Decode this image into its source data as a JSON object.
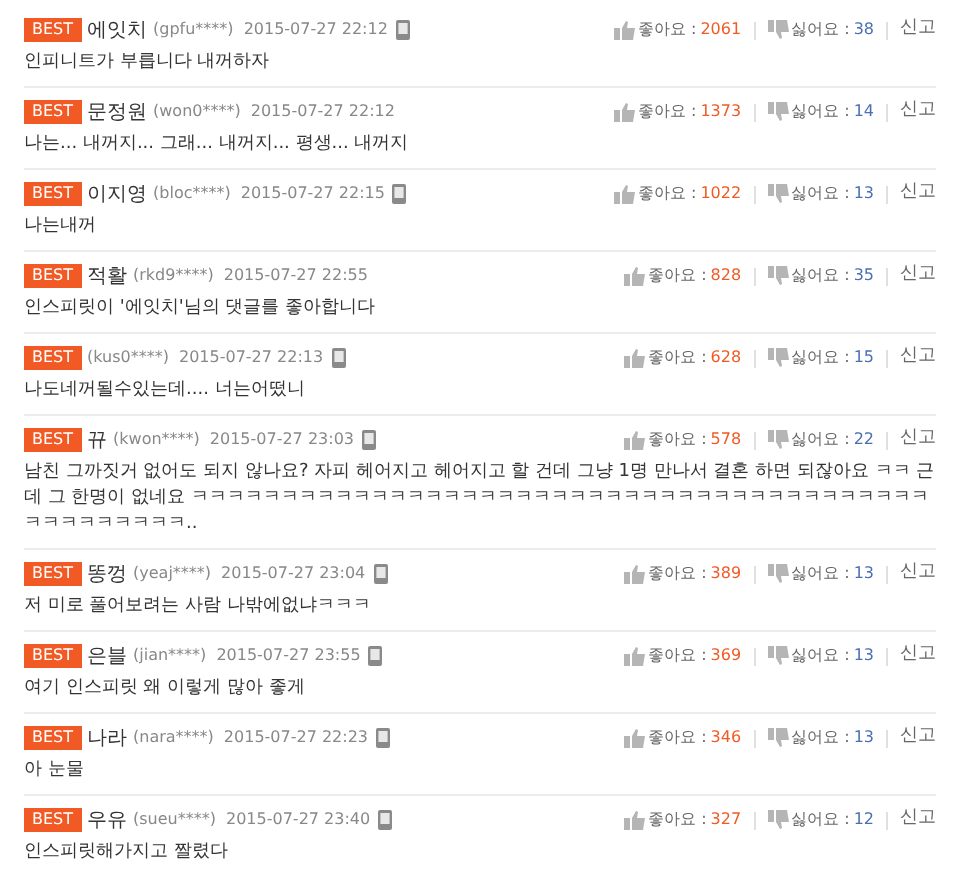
{
  "comments": [
    {
      "badge": "BEST",
      "nickname": "에잇치",
      "user_id": "(gpfu****)",
      "date": "2015-07-27 22:12",
      "mobile": true,
      "text": "인피니트가 부릅니다 내꺼하자",
      "like_label": "좋아요 :",
      "likes": "2061",
      "dislike_label": "싫어요 :",
      "dislikes": "38",
      "report": "신고"
    },
    {
      "badge": "BEST",
      "nickname": "문정원",
      "user_id": "(won0****)",
      "date": "2015-07-27 22:12",
      "mobile": false,
      "text": "나는... 내꺼지... 그래... 내꺼지... 평생... 내꺼지",
      "like_label": "좋아요 :",
      "likes": "1373",
      "dislike_label": "싫어요 :",
      "dislikes": "14",
      "report": "신고"
    },
    {
      "badge": "BEST",
      "nickname": "이지영",
      "user_id": "(bloc****)",
      "date": "2015-07-27 22:15",
      "mobile": true,
      "text": "나는내꺼",
      "like_label": "좋아요 :",
      "likes": "1022",
      "dislike_label": "싫어요 :",
      "dislikes": "13",
      "report": "신고"
    },
    {
      "badge": "BEST",
      "nickname": "적활",
      "user_id": "(rkd9****)",
      "date": "2015-07-27 22:55",
      "mobile": false,
      "text": "인스피릿이 '에잇치'님의 댓글를 좋아합니다",
      "like_label": "좋아요 :",
      "likes": "828",
      "dislike_label": "싫어요 :",
      "dislikes": "35",
      "report": "신고"
    },
    {
      "badge": "BEST",
      "user_id": "(kus0****)",
      "date": "2015-07-27 22:13",
      "mobile": true,
      "text": "나도네꺼될수있는데.... 너는어떴니",
      "like_label": "좋아요 :",
      "likes": "628",
      "dislike_label": "싫어요 :",
      "dislikes": "15",
      "report": "신고"
    },
    {
      "badge": "BEST",
      "nickname": "뀨",
      "user_id": "(kwon****)",
      "date": "2015-07-27 23:03",
      "mobile": true,
      "text": "남친 그까짓거 없어도 되지 않나요? 자피 헤어지고 헤어지고 할 건데 그냥 1명 만나서 결혼 하면 되잖아요 ㅋㅋ 근데 그 한명이 없네요 ㅋㅋㅋㅋㅋㅋㅋㅋㅋㅋㅋㅋㅋㅋㅋㅋㅋㅋㅋㅋㅋㅋㅋㅋㅋㅋㅋㅋㅋㅋㅋㅋㅋㅋㅋㅋㅋㅋㅋㅋㅋㅋㅋㅋㅋㅋㅋㅋㅋㅋ..",
      "like_label": "좋아요 :",
      "likes": "578",
      "dislike_label": "싫어요 :",
      "dislikes": "22",
      "report": "신고"
    },
    {
      "badge": "BEST",
      "nickname": "똥껑",
      "user_id": "(yeaj****)",
      "date": "2015-07-27 23:04",
      "mobile": true,
      "text": "저 미로 풀어보려는 사람 나밖에없냐ㅋㅋㅋ",
      "like_label": "좋아요 :",
      "likes": "389",
      "dislike_label": "싫어요 :",
      "dislikes": "13",
      "report": "신고"
    },
    {
      "badge": "BEST",
      "nickname": "은블",
      "user_id": "(jian****)",
      "date": "2015-07-27 23:55",
      "mobile": true,
      "text": "여기 인스피릿 왜 이렇게 많아 좋게",
      "like_label": "좋아요 :",
      "likes": "369",
      "dislike_label": "싫어요 :",
      "dislikes": "13",
      "report": "신고"
    },
    {
      "badge": "BEST",
      "nickname": "나라",
      "user_id": "(nara****)",
      "date": "2015-07-27 22:23",
      "mobile": true,
      "text": "아 눈물",
      "like_label": "좋아요 :",
      "likes": "346",
      "dislike_label": "싫어요 :",
      "dislikes": "13",
      "report": "신고"
    },
    {
      "badge": "BEST",
      "nickname": "우유",
      "user_id": "(sueu****)",
      "date": "2015-07-27 23:40",
      "mobile": true,
      "text": "인스피릿해가지고 짤렸다",
      "like_label": "좋아요 :",
      "likes": "327",
      "dislike_label": "싫어요 :",
      "dislikes": "12",
      "report": "신고"
    }
  ]
}
